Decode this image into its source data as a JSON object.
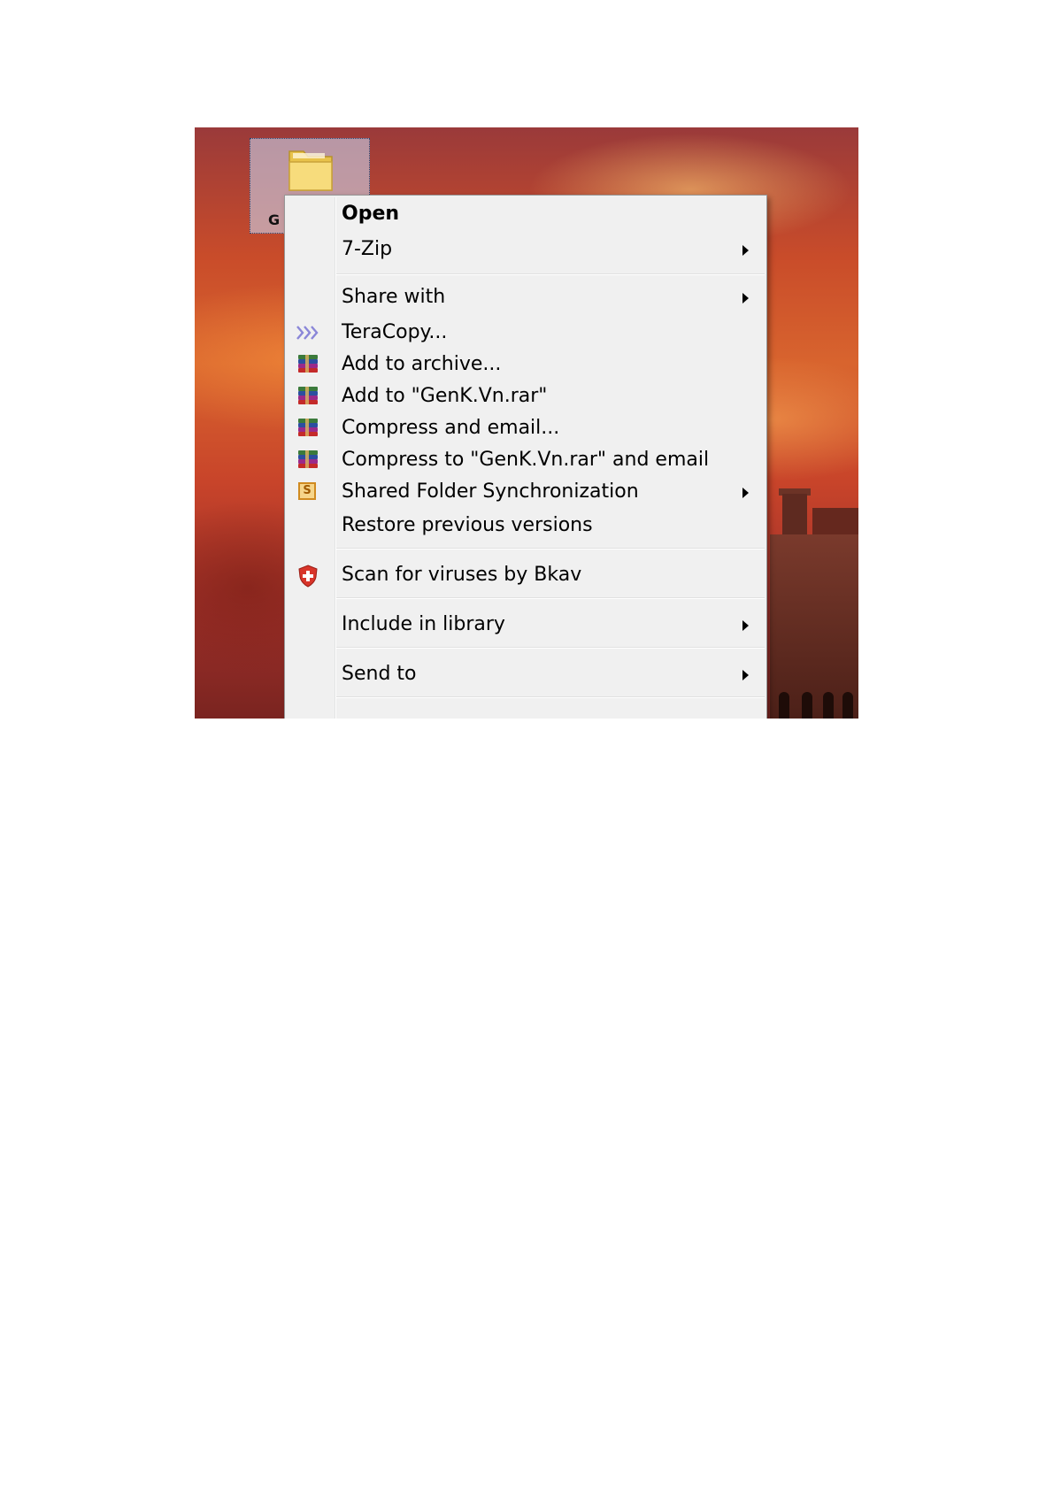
{
  "desktop": {
    "icon_label": "G"
  },
  "context_menu": {
    "items": [
      {
        "label": "Open",
        "bold": true,
        "icon": "",
        "submenu": false
      },
      {
        "label": "7-Zip",
        "icon": "",
        "submenu": true
      },
      {
        "label": "Share with",
        "icon": "",
        "submenu": true
      },
      {
        "label": "TeraCopy...",
        "icon": "teracopy-icon",
        "submenu": false
      },
      {
        "label": "Add to archive...",
        "icon": "winrar-icon",
        "submenu": false
      },
      {
        "label": "Add to \"GenK.Vn.rar\"",
        "icon": "winrar-icon",
        "submenu": false
      },
      {
        "label": "Compress and email...",
        "icon": "winrar-icon",
        "submenu": false
      },
      {
        "label": "Compress to \"GenK.Vn.rar\" and email",
        "icon": "winrar-icon",
        "submenu": false
      },
      {
        "label": "Shared Folder Synchronization",
        "icon": "sync-icon",
        "submenu": true
      },
      {
        "label": "Restore previous versions",
        "icon": "",
        "submenu": false
      },
      {
        "label": "Scan for viruses by Bkav",
        "icon": "bkav-shield-icon",
        "submenu": false
      },
      {
        "label": "Include in library",
        "icon": "",
        "submenu": true
      },
      {
        "label": "Send to",
        "icon": "",
        "submenu": true
      }
    ],
    "sync_icon_glyph": "S"
  },
  "colors": {
    "menu_background": "#f0f0f0",
    "menu_border": "#979797",
    "selection_fill": "#cde1ff"
  }
}
